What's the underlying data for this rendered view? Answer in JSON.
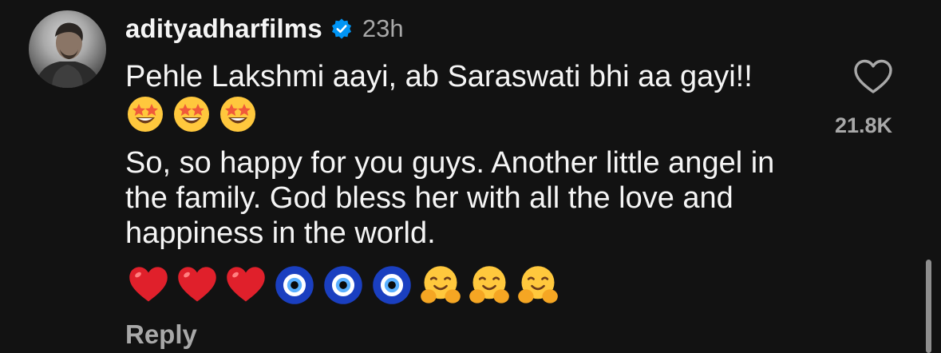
{
  "comment": {
    "username": "adityadharfilms",
    "verified": true,
    "time": "23h",
    "line1": "Pehle Lakshmi aayi, ab Saraswati bhi aa gayi!!",
    "line1_emojis": [
      "star-struck",
      "star-struck",
      "star-struck"
    ],
    "line2": "So, so happy for you guys. Another little angel in the family. God bless her with all the love and happiness in the world.",
    "emojis": [
      "red-heart",
      "red-heart",
      "red-heart",
      "nazar-amulet",
      "nazar-amulet",
      "nazar-amulet",
      "hugging-face",
      "hugging-face",
      "hugging-face"
    ],
    "reply_label": "Reply",
    "like_count": "21.8K"
  },
  "colors": {
    "background": "#121212",
    "text": "#f5f5f5",
    "muted": "#a8a8a8",
    "verified": "#0095f6"
  }
}
